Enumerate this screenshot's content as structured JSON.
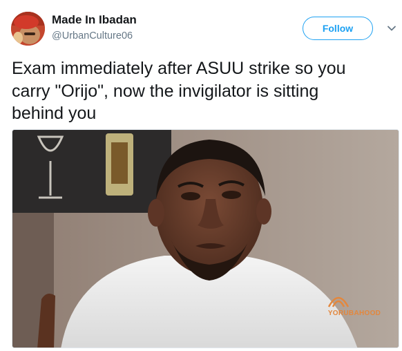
{
  "tweet": {
    "display_name": "Made In Ibadan",
    "handle": "@UrbanCulture06",
    "follow_label": "Follow",
    "text": "Exam immediately after ASUU strike so you\ncarry \"Orijo\", now the invigilator is sitting\nbehind you",
    "media": {
      "watermark": "YORUBAHOOD",
      "watermark_prefix": "YORUBA",
      "watermark_suffix": "HOOD"
    }
  },
  "colors": {
    "accent": "#1da1f2",
    "text": "#14171a",
    "secondary": "#657786",
    "watermark": "#e3873d"
  },
  "icons": {
    "more": "chevron-down-icon",
    "watermark_logo": "yorubahood-logo-icon"
  }
}
